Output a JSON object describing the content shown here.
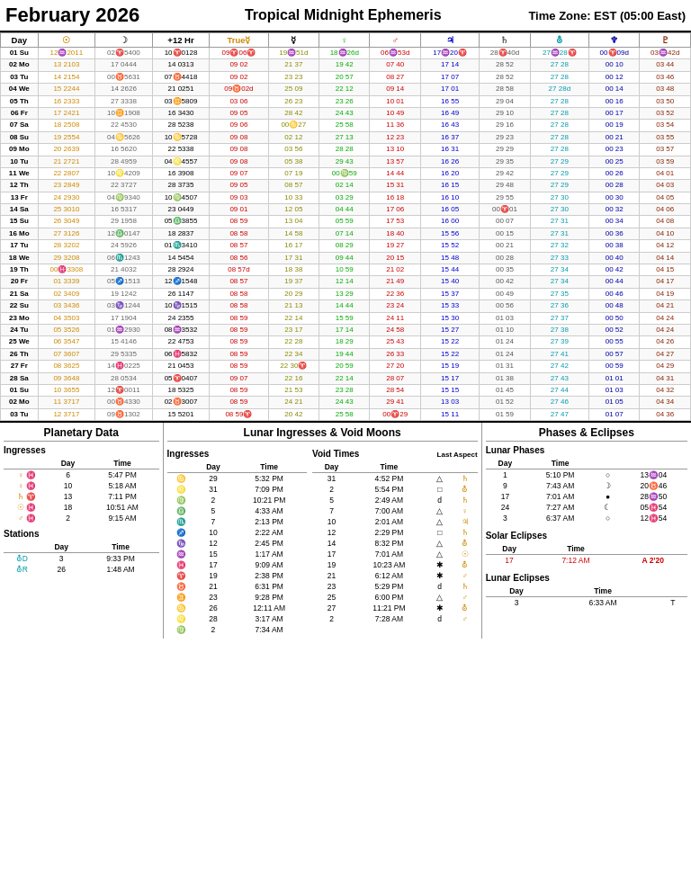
{
  "header": {
    "title": "February 2026",
    "subtitle": "Tropical Midnight Ephemeris",
    "timezone": "Time Zone: EST  (05:00 East)"
  },
  "table": {
    "headers": [
      "Day",
      "☉",
      "☽",
      "+12 Hr",
      "True☿",
      "☿",
      "♀",
      "♂",
      "♃",
      "♄",
      "⛢",
      "♆",
      "♇"
    ],
    "rows": [
      [
        "01 Su",
        "12♒2011",
        "02♈5400",
        "10♈0128",
        "09♈06♈",
        "19♒51d",
        "18♒26d",
        "06♒53d",
        "17♒20♈",
        "28♈40d",
        "27♒28♈",
        "00♈09d",
        "03♒42d"
      ],
      [
        "02 Mo",
        "13  2103",
        "17  0444",
        "14  0313",
        "09  02",
        "21  37",
        "19  42",
        "07  40",
        "17  14",
        "28  52",
        "27  28",
        "00  10",
        "03  44"
      ],
      [
        "03 Tu",
        "14  2154",
        "00♉5631",
        "07♉4418",
        "09  02",
        "23  23",
        "20  57",
        "08  27",
        "17  07",
        "28  52",
        "27  28",
        "00  12",
        "03  46"
      ],
      [
        "04 We",
        "15  2244",
        "14  2626",
        "21  0251",
        "09♉02d",
        "25  09",
        "22  12",
        "09  14",
        "17  01",
        "28  58",
        "27  28d",
        "00  14",
        "03  48"
      ],
      [
        "05 Th",
        "16  2333",
        "27  3338",
        "03♊5809",
        "03  06",
        "26  23",
        "23  26",
        "10  01",
        "16  55",
        "29  04",
        "27  28",
        "00  16",
        "03  50"
      ],
      [
        "06 Fr",
        "17  2421",
        "10♊1908",
        "16  3430",
        "09  05",
        "28  42",
        "24  43",
        "10  49",
        "16  49",
        "29  10",
        "27  28",
        "00  17",
        "03  52"
      ],
      [
        "07 Sa",
        "18  2508",
        "22  4530",
        "28  5238",
        "09  06",
        "00♋27",
        "25  58",
        "11  36",
        "16  43",
        "29  16",
        "27  28",
        "00  19",
        "03  54"
      ],
      [
        "08 Su",
        "19  2554",
        "04♋5626",
        "10♋5728",
        "09  08",
        "02  12",
        "27  13",
        "12  23",
        "16  37",
        "29  23",
        "27  28",
        "00  21",
        "03  55"
      ],
      [
        "09 Mo",
        "20  2639",
        "16  5620",
        "22  5338",
        "09  08",
        "03  56",
        "28  28",
        "13  10",
        "16  31",
        "29  29",
        "27  28",
        "00  23",
        "03  57"
      ],
      [
        "10 Tu",
        "21  2721",
        "28  4959",
        "04♌4557",
        "09  08",
        "05  38",
        "29  43",
        "13  57",
        "16  26",
        "29  35",
        "27  29",
        "00  25",
        "03  59"
      ],
      [
        "11 We",
        "22  2807",
        "10♌4209",
        "16  3908",
        "09  07",
        "07  19",
        "00♍59",
        "14  44",
        "16  20",
        "29  42",
        "27  29",
        "00  26",
        "04  01"
      ],
      [
        "12 Th",
        "23  2849",
        "22  3727",
        "28  3735",
        "09  05",
        "08  57",
        "02  14",
        "15  31",
        "16  15",
        "29  48",
        "27  29",
        "00  28",
        "04  03"
      ],
      [
        "13 Fr",
        "24  2930",
        "04♍9340",
        "10♍4507",
        "09  03",
        "10  33",
        "03  29",
        "16  18",
        "16  10",
        "29  55",
        "27  30",
        "00  30",
        "04  05"
      ],
      [
        "14 Sa",
        "25  3010",
        "16  5317",
        "23  0449",
        "09  01",
        "12  05",
        "04  44",
        "17  06",
        "16  05",
        "00♈01",
        "27  30",
        "00  32",
        "04  06"
      ],
      [
        "15 Su",
        "26  3049",
        "29  1958",
        "05♎3855",
        "08  59",
        "13  04",
        "05  59",
        "17  53",
        "16  00",
        "00  07",
        "27  31",
        "00  34",
        "04  08"
      ],
      [
        "16 Mo",
        "27  3126",
        "12♎0147",
        "18  2837",
        "08  58",
        "14  58",
        "07  14",
        "18  40",
        "15  56",
        "00  15",
        "27  31",
        "00  36",
        "04  10"
      ],
      [
        "17 Tu",
        "28  3202",
        "24  5926",
        "01♏3410",
        "08  57",
        "16  17",
        "08  29",
        "19  27",
        "15  52",
        "00  21",
        "27  32",
        "00  38",
        "04  12"
      ],
      [
        "18 We",
        "29  3208",
        "06♏1243",
        "14  5454",
        "08  56",
        "17  31",
        "09  44",
        "20  15",
        "15  48",
        "00  28",
        "27  33",
        "00  40",
        "04  14"
      ],
      [
        "19 Th",
        "00♓3308",
        "21  4032",
        "28  2924",
        "08  57d",
        "18  38",
        "10  59",
        "21  02",
        "15  44",
        "00  35",
        "27  34",
        "00  42",
        "04  15"
      ],
      [
        "20 Fr",
        "01  3339",
        "05♐1513",
        "12♐1548",
        "08  57",
        "19  37",
        "12  14",
        "21  49",
        "15  40",
        "00  42",
        "27  34",
        "00  44",
        "04  17"
      ],
      [
        "21 Sa",
        "02  3409",
        "19  1242",
        "26  1147",
        "08  58",
        "20  29",
        "13  29",
        "22  36",
        "15  37",
        "00  49",
        "27  35",
        "00  46",
        "04  19"
      ],
      [
        "22 Su",
        "03  3436",
        "03♑1244",
        "10♑1515",
        "08  58",
        "21  13",
        "14  44",
        "23  24",
        "15  33",
        "00  56",
        "27  36",
        "00  48",
        "04  21"
      ],
      [
        "23 Mo",
        "04  3503",
        "17  1904",
        "24  2355",
        "08  59",
        "22  14",
        "15  59",
        "24  11",
        "15  30",
        "01  03",
        "27  37",
        "00  50",
        "04  24"
      ],
      [
        "24 Tu",
        "05  3526",
        "01♒2930",
        "08♒3532",
        "08  59",
        "23  17",
        "17  14",
        "24  58",
        "15  27",
        "01  10",
        "27  38",
        "00  52",
        "04  24"
      ],
      [
        "25 We",
        "06  3547",
        "15  4146",
        "22  4753",
        "08  59",
        "22  28",
        "18  29",
        "25  43",
        "15  22",
        "01  24",
        "27  39",
        "00  55",
        "04  26"
      ],
      [
        "26 Th",
        "07  3607",
        "29  5335",
        "06♓5832",
        "08  59",
        "22  34",
        "19  44",
        "26  33",
        "15  22",
        "01  24",
        "27  41",
        "00  57",
        "04  27"
      ],
      [
        "27 Fr",
        "08  3625",
        "14♓0225",
        "21  0453",
        "08  59",
        "22  30♈",
        "20  59",
        "27  20",
        "15  19",
        "01  31",
        "27  42",
        "00  59",
        "04  29"
      ],
      [
        "28 Sa",
        "09  3648",
        "28  0534",
        "05♈0407",
        "09  07",
        "22  16",
        "22  14",
        "28  07",
        "15  17",
        "01  38",
        "27  43",
        "01  01",
        "04  31"
      ],
      [
        "01 Su",
        "10  3655",
        "12♈0011",
        "18  5325",
        "08  59",
        "21  53",
        "23  28",
        "28  54",
        "15  15",
        "01  45",
        "27  44",
        "01  03",
        "04  32"
      ],
      [
        "02 Mo",
        "11  3717",
        "00♉4330",
        "02♉3007",
        "08  59",
        "24  21",
        "24  43",
        "29  41",
        "13  03",
        "01  52",
        "27  46",
        "01  05",
        "04  34"
      ],
      [
        "03 Tu",
        "12  3717",
        "09♉1302",
        "15  5201",
        "08  59♈",
        "20  42",
        "25  58",
        "00♈29",
        "15  11",
        "01  59",
        "27  47",
        "01  07",
        "04  36"
      ]
    ]
  },
  "planetary_data": {
    "title": "Planetary Data",
    "ingresses_title": "Ingresses",
    "ingresses_cols": [
      "",
      "Day",
      "Time"
    ],
    "ingresses": [
      {
        "planet": "♀",
        "sign": "♓",
        "day": "6",
        "time": "5:47 PM"
      },
      {
        "planet": "♀",
        "sign": "♓",
        "day": "10",
        "time": "5:18 AM"
      },
      {
        "planet": "♄",
        "sign": "♈",
        "day": "13",
        "time": "7:11 PM"
      },
      {
        "planet": "☉",
        "sign": "♓",
        "day": "18",
        "time": "10:51 AM"
      },
      {
        "planet": "♂",
        "sign": "♓",
        "day": "2",
        "time": "9:15 AM"
      }
    ],
    "stations_title": "Stations",
    "stations_cols": [
      "",
      "Day",
      "Time"
    ],
    "stations": [
      {
        "planet": "⛢D",
        "day": "3",
        "time": "9:33 PM"
      },
      {
        "planet": "⛢R",
        "day": "26",
        "time": "1:48 AM"
      }
    ]
  },
  "lunar_ingresses": {
    "title": "Lunar Ingresses & Void Moons",
    "ingresses_title": "Ingresses",
    "ingresses_cols": [
      "",
      "Day",
      "Time"
    ],
    "ingresses": [
      {
        "sign": "♋",
        "day": "29",
        "time": "5:32 PM"
      },
      {
        "sign": "♌",
        "day": "31",
        "time": "7:09 PM"
      },
      {
        "sign": "♍",
        "day": "2",
        "time": "10:21 PM"
      },
      {
        "sign": "♎",
        "day": "5",
        "time": "4:33 AM"
      },
      {
        "sign": "♏",
        "day": "7",
        "time": "2:13 PM"
      },
      {
        "sign": "♐",
        "day": "10",
        "time": "2:22 AM"
      },
      {
        "sign": "♑",
        "day": "12",
        "time": "2:45 PM"
      },
      {
        "sign": "♒",
        "day": "15",
        "time": "1:17 AM"
      },
      {
        "sign": "♓",
        "day": "17",
        "time": "9:09 AM"
      },
      {
        "sign": "♈",
        "day": "19",
        "time": "2:38 PM"
      },
      {
        "sign": "♉",
        "day": "21",
        "time": "6:31 PM"
      },
      {
        "sign": "♊",
        "day": "23",
        "time": "9:28 PM"
      },
      {
        "sign": "♋",
        "day": "26",
        "time": "12:11 AM"
      },
      {
        "sign": "♌",
        "day": "28",
        "time": "3:17 AM"
      },
      {
        "sign": "♍",
        "day": "2",
        "time": "7:34 AM"
      }
    ],
    "void_title": "Void Times",
    "void_last_aspect": "Last Aspect",
    "void_times": [
      {
        "day": "31",
        "time": "4:52 PM",
        "aspect": "△",
        "planet": "♄"
      },
      {
        "day": "2",
        "time": "5:54 PM",
        "aspect": "□",
        "planet": "⛢"
      },
      {
        "day": "5",
        "time": "2:49 AM",
        "aspect": "d",
        "planet": "♄"
      },
      {
        "day": "7",
        "time": "7:00 AM",
        "aspect": "△",
        "planet": "♀"
      },
      {
        "day": "10",
        "time": "2:01 AM",
        "aspect": "△",
        "planet": "♃"
      },
      {
        "day": "12",
        "time": "2:29 PM",
        "aspect": "□",
        "planet": "♄"
      },
      {
        "day": "14",
        "time": "8:32 PM",
        "aspect": "△",
        "planet": "⛢"
      },
      {
        "day": "17",
        "time": "7:01 AM",
        "aspect": "△",
        "planet": "☉"
      },
      {
        "day": "19",
        "time": "10:23 AM",
        "aspect": "✱",
        "planet": "⛢"
      },
      {
        "day": "21",
        "time": "6:12 AM",
        "aspect": "✱",
        "planet": "♂"
      },
      {
        "day": "23",
        "time": "5:29 PM",
        "aspect": "d",
        "planet": "♄"
      },
      {
        "day": "25",
        "time": "6:00 PM",
        "aspect": "△",
        "planet": "♂"
      },
      {
        "day": "27",
        "time": "11:21 PM",
        "aspect": "✱",
        "planet": "⛢"
      },
      {
        "day": "2",
        "time": "7:28 AM",
        "aspect": "d",
        "planet": "♂"
      }
    ]
  },
  "phases_eclipses": {
    "title": "Phases & Eclipses",
    "lunar_phases_title": "Lunar Phases",
    "lunar_phases_cols": [
      "Day",
      "Time",
      "",
      ""
    ],
    "lunar_phases": [
      {
        "day": "1",
        "time": "5:10 PM",
        "symbol": "○",
        "value": "13♒04"
      },
      {
        "day": "9",
        "time": "7:43 AM",
        "symbol": "☽",
        "value": "20♉46"
      },
      {
        "day": "17",
        "time": "7:01 AM",
        "symbol": "●",
        "value": "28♒50"
      },
      {
        "day": "24",
        "time": "7:27 AM",
        "symbol": "☾",
        "value": "05♓54"
      },
      {
        "day": "3",
        "time": "6:37 AM",
        "symbol": "○",
        "value": "12♓54"
      }
    ],
    "solar_eclipses_title": "Solar Eclipses",
    "solar_eclipses_cols": [
      "Day",
      "Time"
    ],
    "solar_eclipses": [
      {
        "day": "17",
        "time": "7:12 AM",
        "type": "A 2'20"
      }
    ],
    "lunar_eclipses_title": "Lunar Eclipses",
    "lunar_eclipses_cols": [
      "Day",
      "Time"
    ],
    "lunar_eclipses": [
      {
        "day": "3",
        "time": "6:33 AM",
        "type": "T"
      }
    ]
  }
}
